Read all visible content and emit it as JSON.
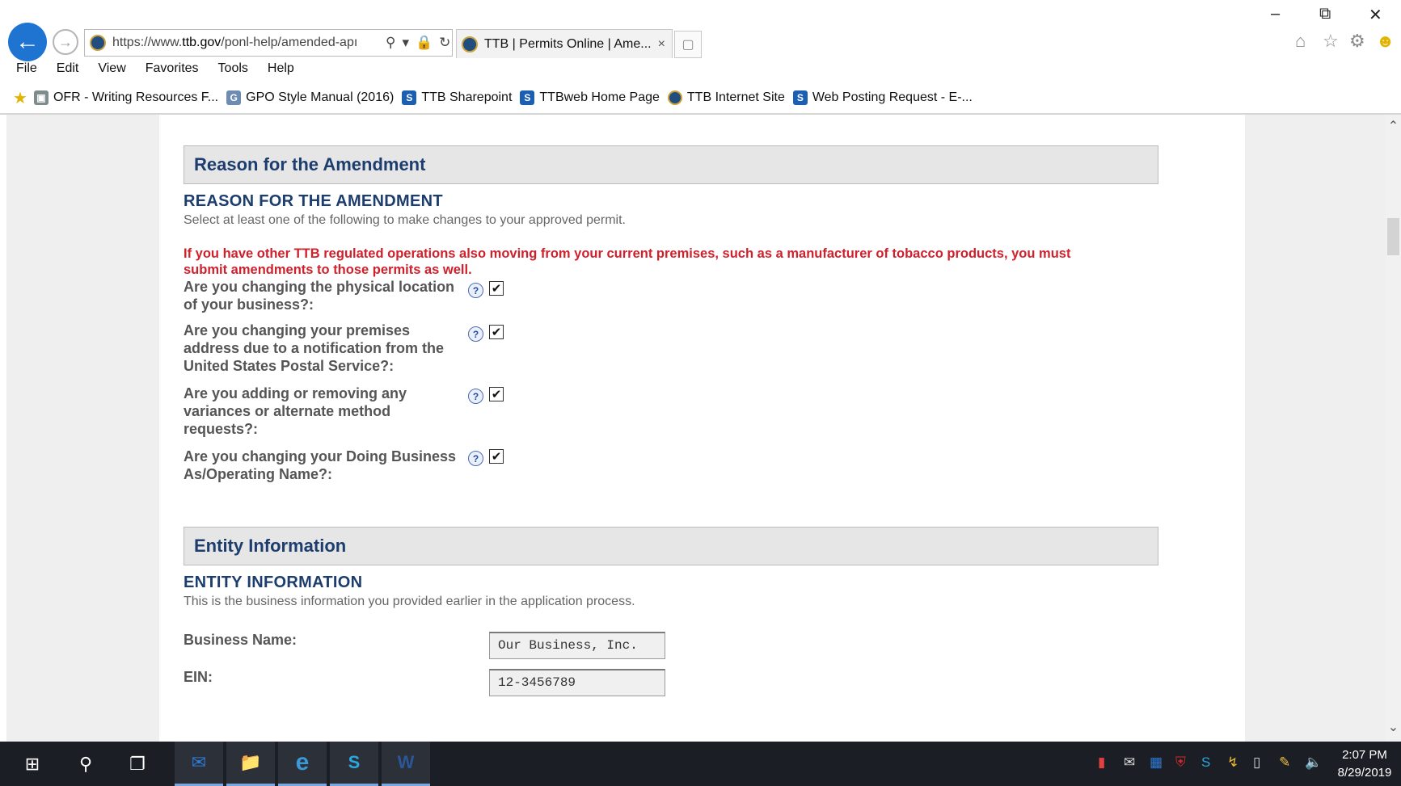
{
  "browser": {
    "url": "https://www.ttb.gov/ponl-help/amended-app",
    "url_domain": "ttb.gov",
    "url_prefix": "https://www.",
    "url_suffix": "/ponl-help/amended-apı",
    "tab_title": "TTB | Permits Online | Ame...",
    "tab_close": "×",
    "window_controls": [
      "–",
      "⧉",
      "✕"
    ]
  },
  "menubar": [
    "File",
    "Edit",
    "View",
    "Favorites",
    "Tools",
    "Help"
  ],
  "favorites": [
    {
      "label": "OFR - Writing Resources F...",
      "icon": "document-icon"
    },
    {
      "label": "GPO Style Manual (2016)",
      "icon": "gpo-icon"
    },
    {
      "label": "TTB Sharepoint",
      "icon": "sharepoint-icon"
    },
    {
      "label": "TTBweb Home Page",
      "icon": "sharepoint-icon"
    },
    {
      "label": "TTB Internet Site",
      "icon": "ttb-seal-icon"
    },
    {
      "label": "Web Posting Request - E-...",
      "icon": "sharepoint-icon"
    }
  ],
  "reason_section": {
    "bar_title": "Reason for the Amendment",
    "heading": "REASON FOR THE AMENDMENT",
    "description": "Select at least one of the following to make changes to your approved permit.",
    "warning": "If you have other TTB regulated operations also moving from your current premises, such as a manufacturer of tobacco products, you must submit amendments to those permits as well.",
    "questions": [
      {
        "label": "Are you changing the physical location of your business?:",
        "checked": true
      },
      {
        "label": "Are you changing your premises address due to a notification from the United States Postal Service?:",
        "checked": true
      },
      {
        "label": "Are you adding or removing any variances or alternate method requests?:",
        "checked": true
      },
      {
        "label": "Are you changing your Doing Business As/Operating Name?:",
        "checked": true
      }
    ],
    "help_symbol": "?",
    "check_symbol": "✔"
  },
  "entity_section": {
    "bar_title": "Entity Information",
    "heading": "ENTITY INFORMATION",
    "description": "This is the business information you provided earlier in the application process.",
    "business_name_label": "Business Name:",
    "business_name_value": "Our Business, Inc.",
    "ein_label": "EIN:",
    "ein_value": "12-3456789"
  },
  "taskbar": {
    "time": "2:07 PM",
    "date": "8/29/2019"
  },
  "colors": {
    "heading_blue": "#1c3d6e",
    "warning_red": "#d0202c",
    "back_button": "#1f73d1"
  }
}
